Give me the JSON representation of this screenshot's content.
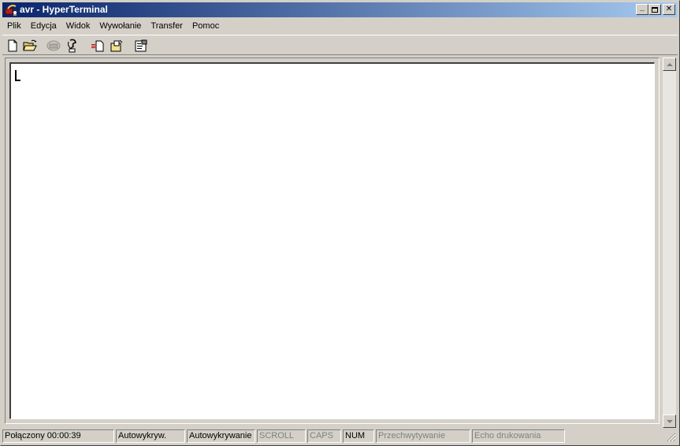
{
  "window": {
    "title": "avr - HyperTerminal",
    "minimize_glyph": "_",
    "maximize_glyph": "□",
    "close_glyph": "✕"
  },
  "menu": {
    "items": [
      {
        "label": "Plik"
      },
      {
        "label": "Edycja"
      },
      {
        "label": "Widok"
      },
      {
        "label": "Wywołanie"
      },
      {
        "label": "Transfer"
      },
      {
        "label": "Pomoc"
      }
    ]
  },
  "toolbar": {
    "buttons": [
      {
        "icon": "new-document-icon"
      },
      {
        "icon": "open-folder-icon"
      },
      {
        "icon": "phone-icon",
        "disabled": true
      },
      {
        "icon": "disconnect-icon"
      },
      {
        "icon": "send-file-icon"
      },
      {
        "icon": "receive-file-icon"
      },
      {
        "icon": "properties-icon"
      }
    ]
  },
  "statusbar": {
    "connection": "Połączony 00:00:39",
    "autodetect_short": "Autowykryw.",
    "autodetect": "Autowykrywanie",
    "scroll": "SCROLL",
    "caps": "CAPS",
    "num": "NUM",
    "capture": "Przechwytywanie",
    "echo": "Echo drukowania"
  },
  "colors": {
    "title_start": "#0a246a",
    "title_end": "#a6caf0",
    "face": "#d4d0c8",
    "terminal_bg": "#ffffff"
  }
}
